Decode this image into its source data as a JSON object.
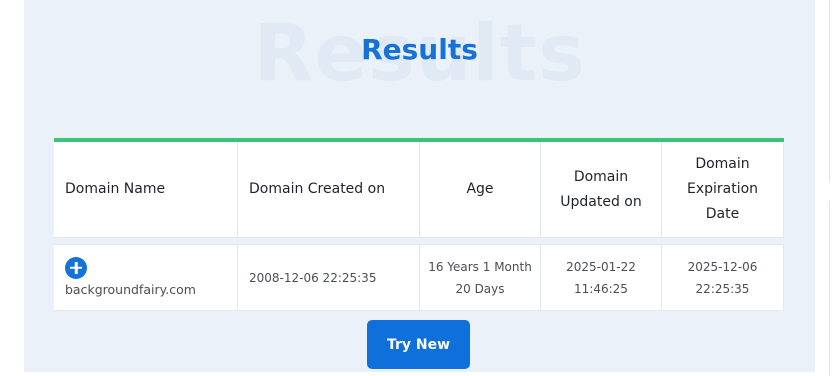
{
  "section": {
    "watermark": "Results",
    "title": "Results"
  },
  "colors": {
    "accent_bar": "#3cc37a",
    "title": "#1472d8",
    "button": "#0f6fdb",
    "panel_bg": "#eaf1f9"
  },
  "table": {
    "headers": [
      "Domain Name",
      "Domain Created on",
      "Age",
      "Domain Updated on",
      "Domain Expiration Date"
    ],
    "header_lines": {
      "updated": [
        "Domain",
        "Updated on"
      ],
      "expiration": [
        "Domain",
        "Expiration",
        "Date"
      ]
    },
    "rows": [
      {
        "expand_icon": "plus-circle-icon",
        "domain": "backgroundfairy.com",
        "created": "2008-12-06 22:25:35",
        "age_lines": [
          "16 Years 1 Month",
          "20 Days"
        ],
        "updated_lines": [
          "2025-01-22",
          "11:46:25"
        ],
        "expiration_lines": [
          "2025-12-06",
          "22:25:35"
        ]
      }
    ]
  },
  "actions": {
    "try_new_label": "Try New"
  }
}
